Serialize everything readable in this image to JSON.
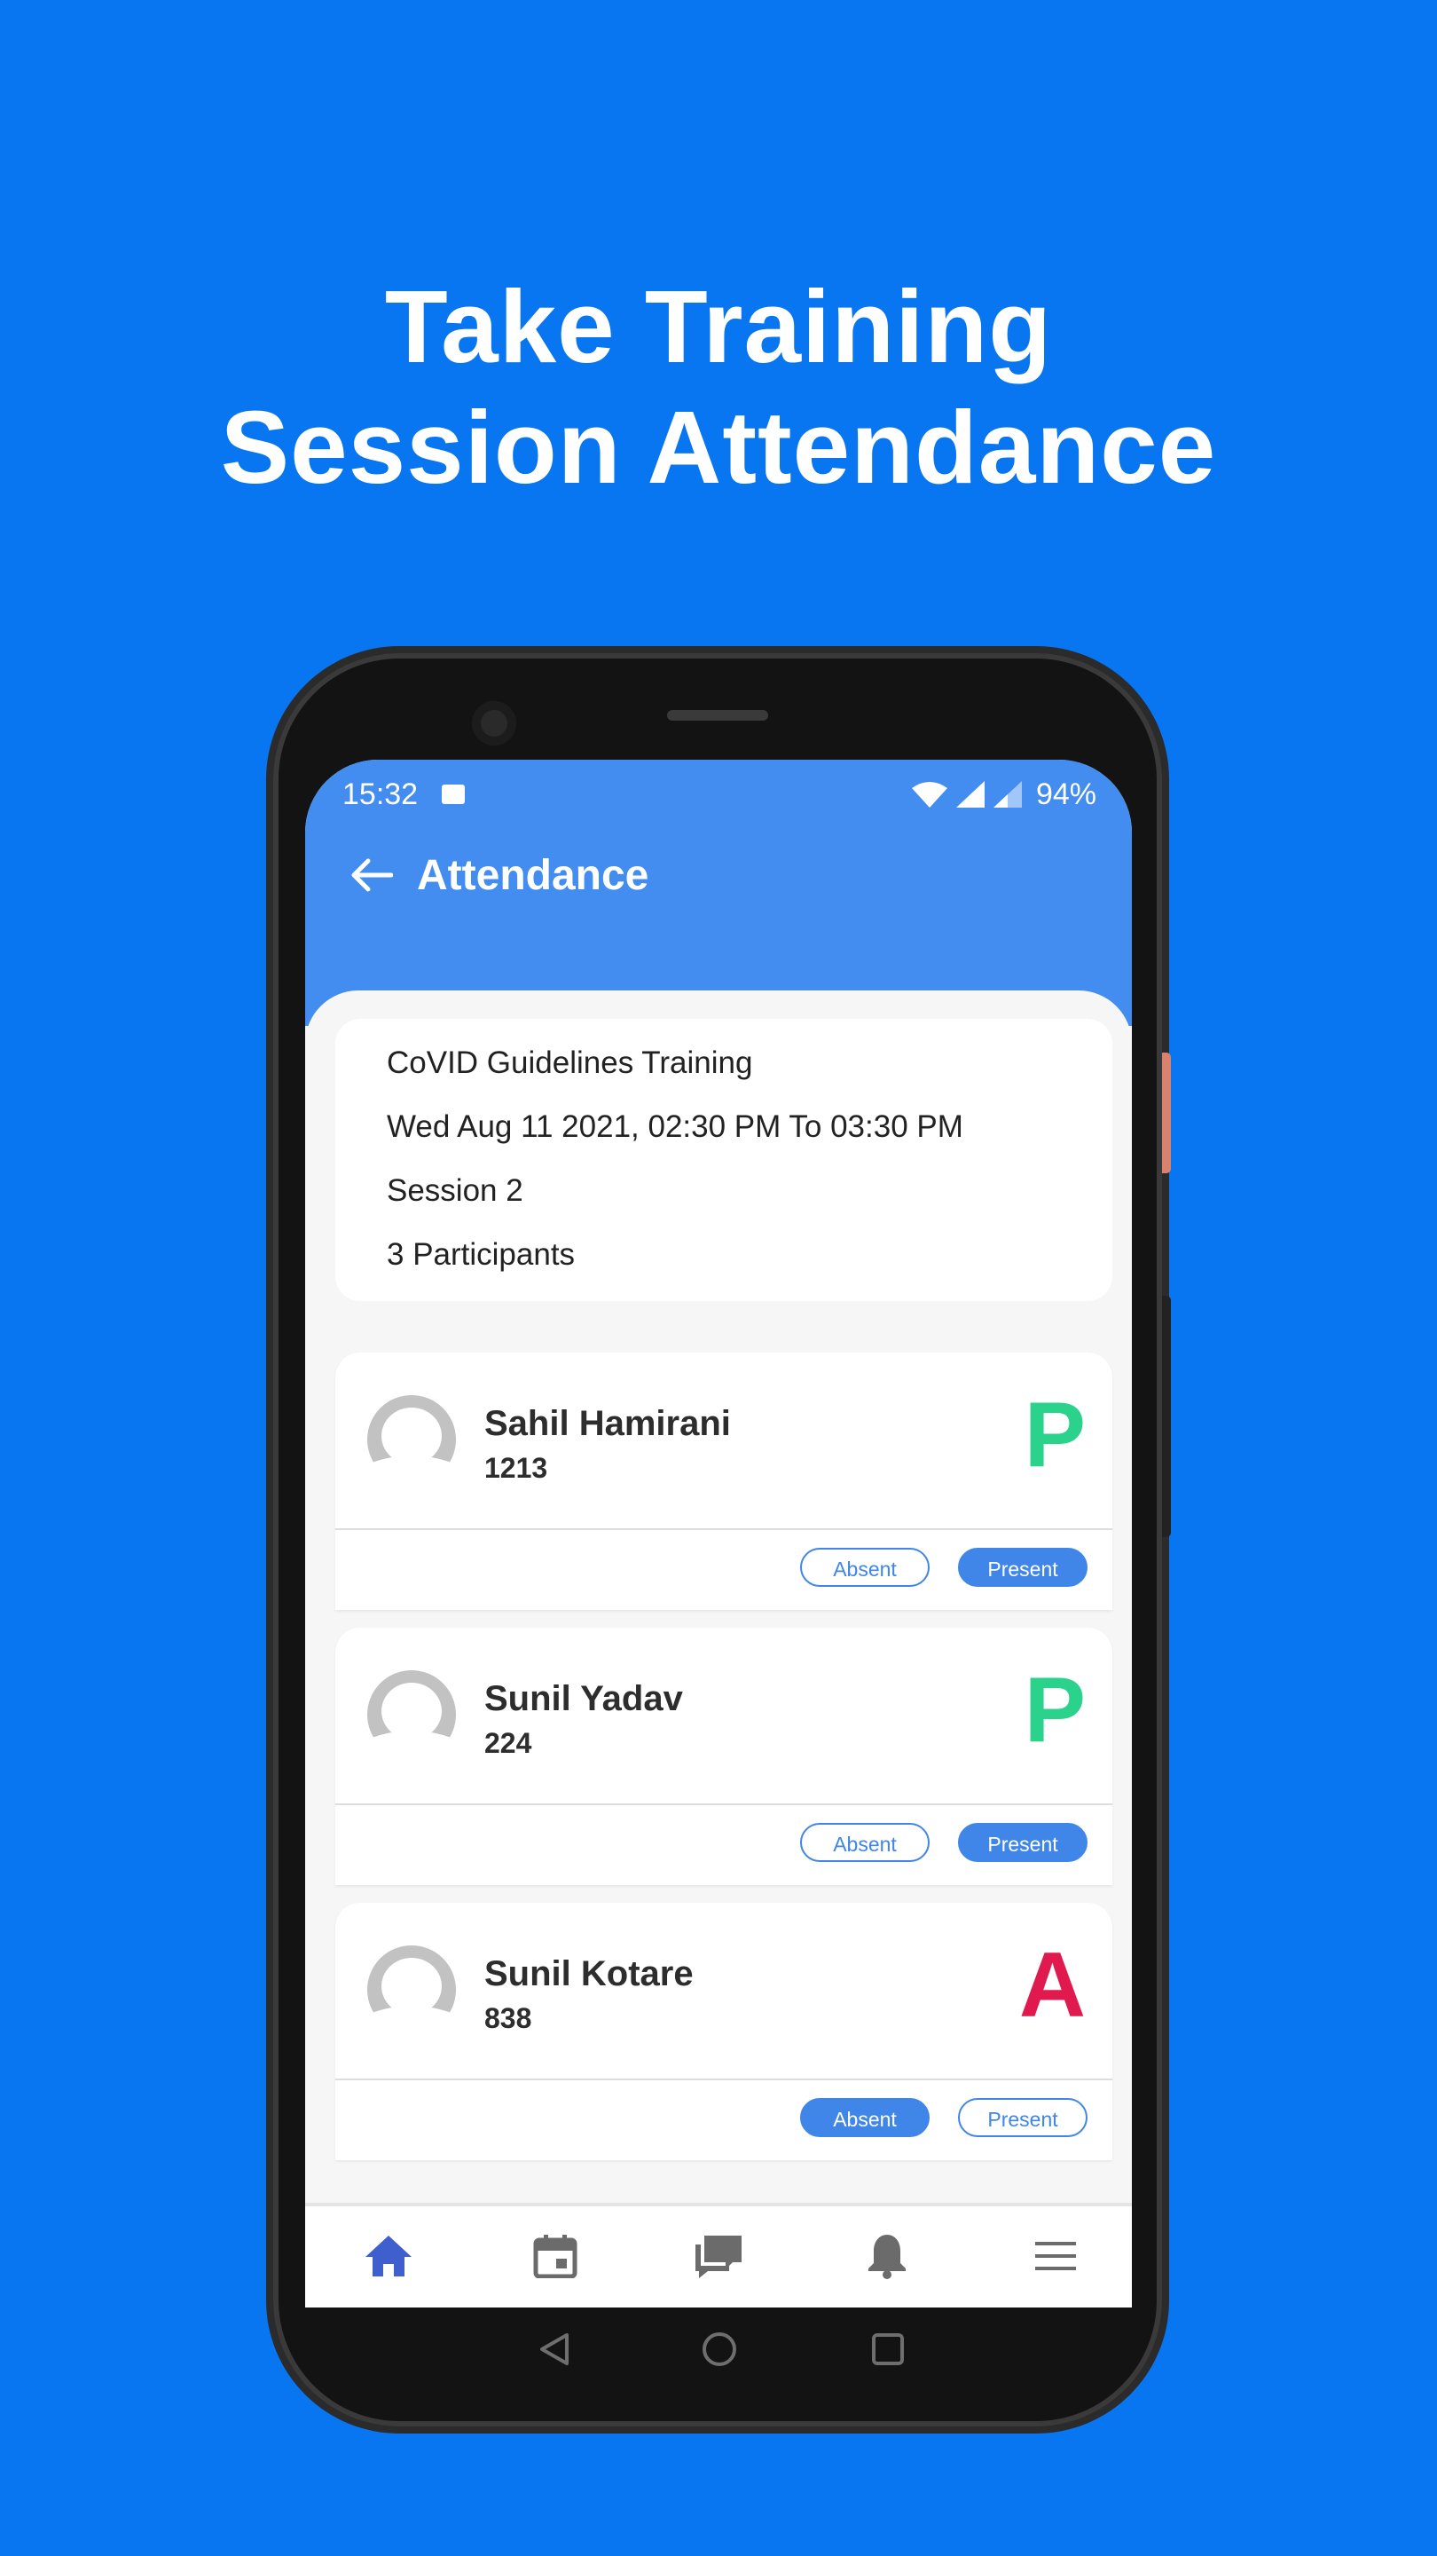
{
  "headline": {
    "line1": "Take Training",
    "line2": "Session Attendance"
  },
  "status_bar": {
    "time": "15:32",
    "battery": "94%"
  },
  "appbar": {
    "title": "Attendance"
  },
  "session": {
    "name": "CoVID Guidelines Training",
    "datetime": "Wed Aug 11 2021, 02:30 PM To 03:30 PM",
    "session_label": "Session 2",
    "participants": "3 Participants"
  },
  "participants": [
    {
      "name": "Sahil Hamirani",
      "id": "1213",
      "status": "P",
      "status_color": "#2ad28b",
      "selected": "present"
    },
    {
      "name": "Sunil Yadav",
      "id": "224",
      "status": "P",
      "status_color": "#2ad28b",
      "selected": "present"
    },
    {
      "name": "Sunil Kotare",
      "id": "838",
      "status": "A",
      "status_color": "#e0194f",
      "selected": "absent"
    }
  ],
  "buttons": {
    "absent": "Absent",
    "present": "Present"
  },
  "bottom_nav": {
    "items": [
      "home-icon",
      "calendar-icon",
      "chat-icon",
      "bell-icon",
      "menu-icon"
    ],
    "active": "home-icon",
    "active_color": "#3f5fcf",
    "inactive_color": "#6b6b6b"
  },
  "colors": {
    "background": "#0876f0",
    "appbar": "#438cf0",
    "accent": "#3f86e8"
  }
}
